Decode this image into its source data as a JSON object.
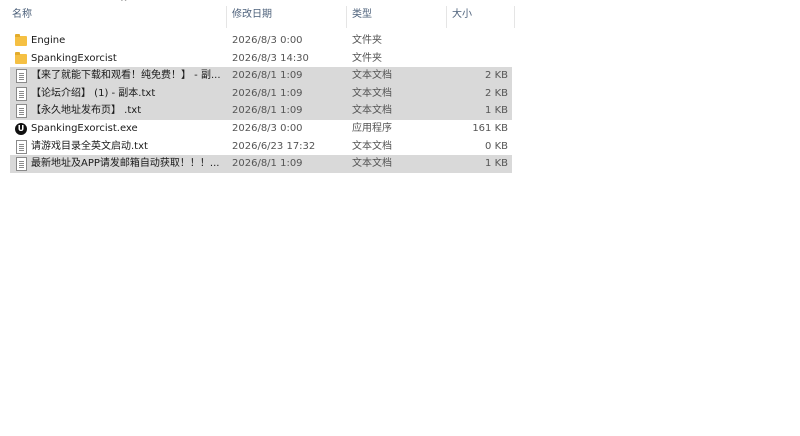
{
  "columns": {
    "name": "名称",
    "date": "修改日期",
    "type": "类型",
    "size": "大小"
  },
  "files": [
    {
      "icon": "folder-icon",
      "name": "Engine",
      "date": "2026/8/3 0:00",
      "type": "文件夹",
      "size": "",
      "selected": false
    },
    {
      "icon": "folder-icon",
      "name": "SpankingExorcist",
      "date": "2026/8/3 14:30",
      "type": "文件夹",
      "size": "",
      "selected": false
    },
    {
      "icon": "text-file-icon",
      "name": "【来了就能下载和观看！纯免费！】 - 副...",
      "date": "2026/8/1 1:09",
      "type": "文本文档",
      "size": "2 KB",
      "selected": true
    },
    {
      "icon": "text-file-icon",
      "name": "【论坛介绍】 (1) - 副本.txt",
      "date": "2026/8/1 1:09",
      "type": "文本文档",
      "size": "2 KB",
      "selected": true
    },
    {
      "icon": "text-file-icon",
      "name": "【永久地址发布页】 .txt",
      "date": "2026/8/1 1:09",
      "type": "文本文档",
      "size": "1 KB",
      "selected": true
    },
    {
      "icon": "unreal-engine-icon",
      "name": "SpankingExorcist.exe",
      "date": "2026/8/3 0:00",
      "type": "应用程序",
      "size": "161 KB",
      "selected": false
    },
    {
      "icon": "text-file-icon",
      "name": "请游戏目录全英文启动.txt",
      "date": "2026/6/23 17:32",
      "type": "文本文档",
      "size": "0 KB",
      "selected": false
    },
    {
      "icon": "text-file-icon",
      "name": "最新地址及APP请发邮箱自动获取！！！...",
      "date": "2026/8/1 1:09",
      "type": "文本文档",
      "size": "1 KB",
      "selected": true
    }
  ]
}
